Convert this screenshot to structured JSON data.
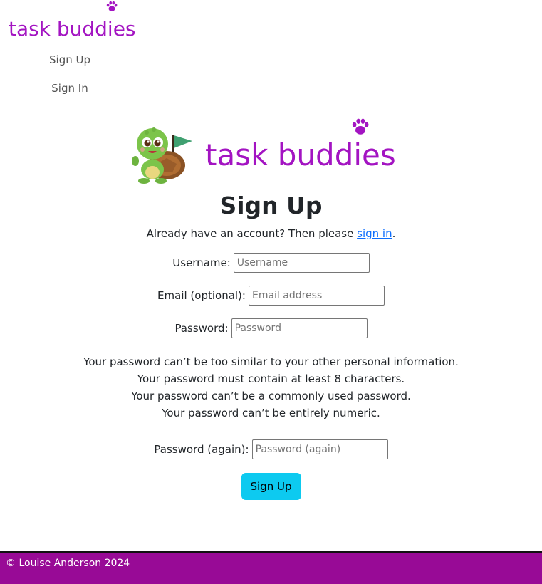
{
  "header": {
    "brand": {
      "before_paw": "task budd",
      "paw_letter": "i",
      "after_paw": "es"
    },
    "nav": [
      {
        "label": "Sign Up"
      },
      {
        "label": "Sign In"
      }
    ]
  },
  "logo": {
    "mascot_icon": "turtle-mascot-icon",
    "brand": {
      "before_paw": "task budd",
      "paw_letter": "i",
      "after_paw": "es"
    },
    "paw_icon": "paw-icon"
  },
  "main": {
    "title": "Sign Up",
    "intro_text": "Already have an account? Then please ",
    "intro_link": "sign in",
    "intro_end": ".",
    "fields": [
      {
        "label": "Username:",
        "placeholder": "Username",
        "value": ""
      },
      {
        "label": "Email (optional):",
        "placeholder": "Email address",
        "value": ""
      },
      {
        "label": "Password:",
        "placeholder": "Password",
        "value": ""
      }
    ],
    "help_text": [
      "Your password can’t be too similar to your other personal information.",
      "Your password must contain at least 8 characters.",
      "Your password can’t be a commonly used password.",
      "Your password can’t be entirely numeric."
    ],
    "confirm_field": {
      "label": "Password (again):",
      "placeholder": "Password (again)",
      "value": ""
    },
    "submit_label": "Sign Up"
  },
  "footer": {
    "text": "© Louise Anderson 2024"
  },
  "colors": {
    "brand": "#a314c2",
    "footer_bg": "#980a96",
    "button_bg": "#0dcaf0",
    "link": "#0d6efd"
  }
}
